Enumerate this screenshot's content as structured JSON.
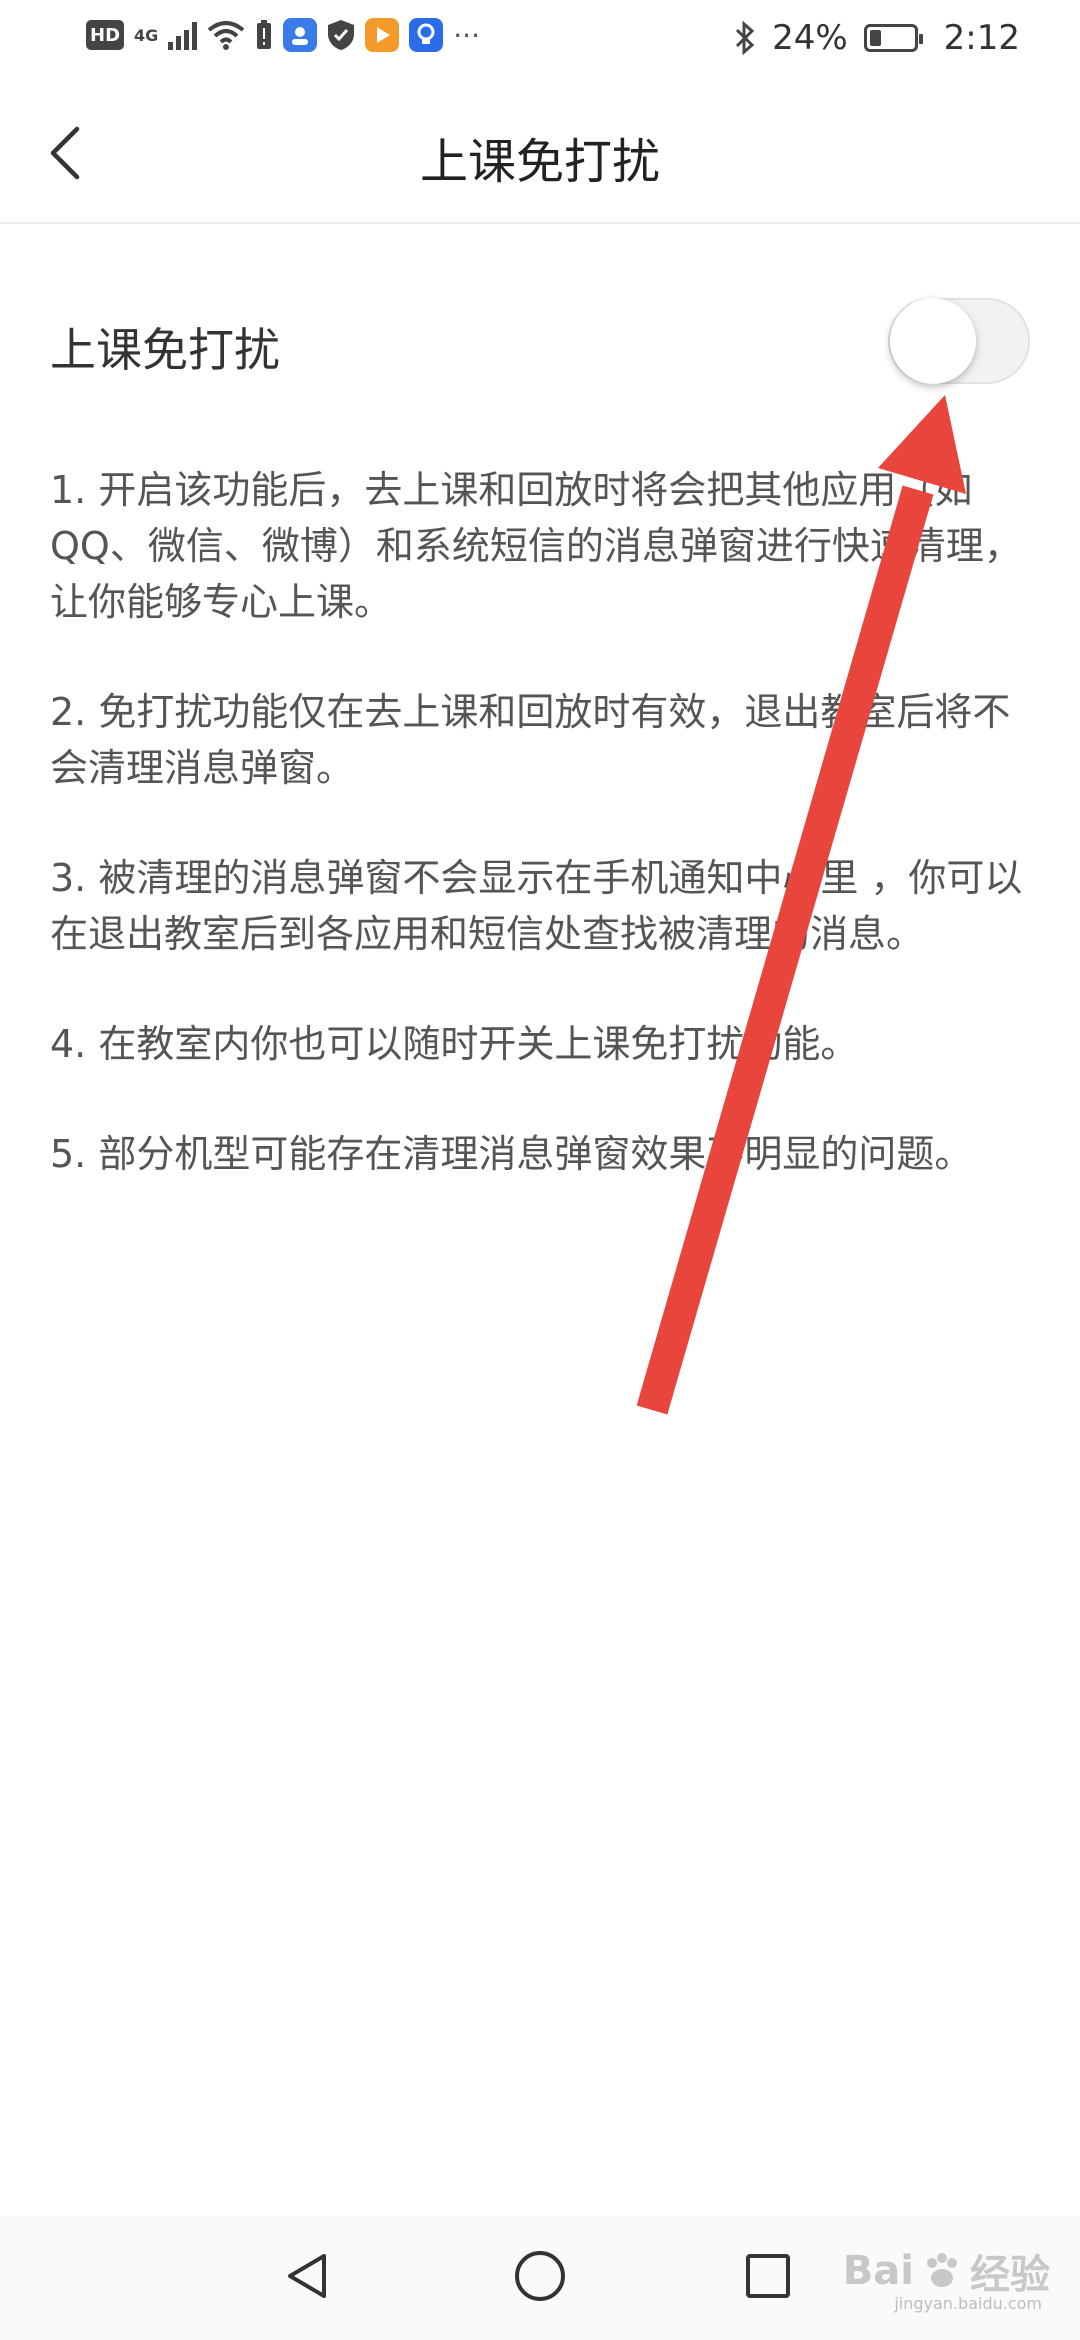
{
  "status_bar": {
    "hd_badge": "HD",
    "network": "4G",
    "battery_percent": "24%",
    "time": "2:12",
    "more": "···",
    "icons": [
      "hd-icon",
      "signal-icon",
      "wifi-icon",
      "battery-alert-icon",
      "app-icon-blue",
      "shield-icon",
      "video-app-icon",
      "lightbulb-app-icon",
      "bluetooth-icon"
    ]
  },
  "header": {
    "title": "上课免打扰",
    "back_icon": "chevron-left-icon"
  },
  "setting": {
    "label": "上课免打扰",
    "enabled": false
  },
  "description": {
    "items": [
      "1. 开启该功能后，去上课和回放时将会把其他应用（如QQ、微信、微博）和系统短信的消息弹窗进行快速清理，让你能够专心上课。",
      "2. 免打扰功能仅在去上课和回放时有效，退出教室后将不会清理消息弹窗。",
      "3. 被清理的消息弹窗不会显示在手机通知中心里 ，你可以在退出教室后到各应用和短信处查找被清理的消息。",
      "4. 在教室内你也可以随时开关上课免打扰功能。",
      "5. 部分机型可能存在清理消息弹窗效果不明显的问题。"
    ]
  },
  "annotation": {
    "color": "#e8453c"
  },
  "nav_bar": {
    "icons": [
      "back-triangle-icon",
      "home-circle-icon",
      "recents-square-icon"
    ]
  },
  "watermark": {
    "brand": "Bai",
    "brand_cn": "经验",
    "url": "jingyan.baidu.com"
  }
}
